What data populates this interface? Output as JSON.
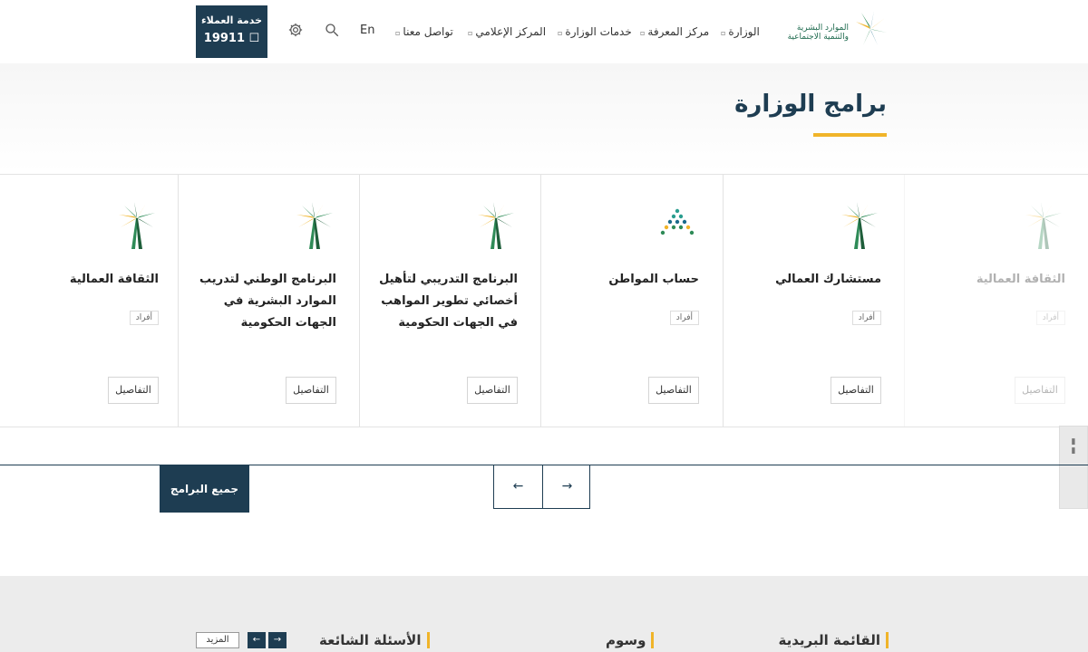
{
  "header": {
    "customer_service_title": "خدمة العملاء",
    "customer_service_number": "19911 ☐",
    "lang_toggle": "En",
    "nav": [
      {
        "label": "الوزارة"
      },
      {
        "label": "مركز المعرفة"
      },
      {
        "label": "خدمات الوزارة"
      },
      {
        "label": "المركز الإعلامي"
      },
      {
        "label": "تواصل معنا"
      }
    ],
    "logo_text_1": "الموارد البشرية",
    "logo_text_2": "والتنمية الاجتماعية"
  },
  "section": {
    "title": "برامج الوزارة"
  },
  "cards": [
    {
      "title": "الثقافة العمالية",
      "tag": "أفراد",
      "details": "التفاصيل"
    },
    {
      "title": "البرنامج الوطني لتدريب الموارد البشرية في الجهات الحكومية",
      "tag": "",
      "details": "التفاصيل"
    },
    {
      "title": "البرنامج التدريبي لتأهيل أخصائي تطوير المواهب في الجهات الحكومية",
      "tag": "",
      "details": "التفاصيل"
    },
    {
      "title": "حساب المواطن",
      "tag": "أفراد",
      "details": "التفاصيل"
    },
    {
      "title": "مستشارك العمالي",
      "tag": "أفراد",
      "details": "التفاصيل"
    },
    {
      "title": "الثقافة العمالية",
      "tag": "أفراد",
      "details": "التفاصيل"
    }
  ],
  "controls": {
    "all_programs": "جميع البرامج",
    "prev_arrow": "←",
    "next_arrow": "→"
  },
  "footer": {
    "mailing_list": "القائمة البريدية",
    "tags": "وسوم",
    "faq": "الأسئلة الشائعة",
    "more": "المزيد",
    "arrow_left": "←",
    "arrow_right": "→"
  },
  "colors": {
    "primary": "#1e3d52",
    "accent": "#f0b429"
  }
}
